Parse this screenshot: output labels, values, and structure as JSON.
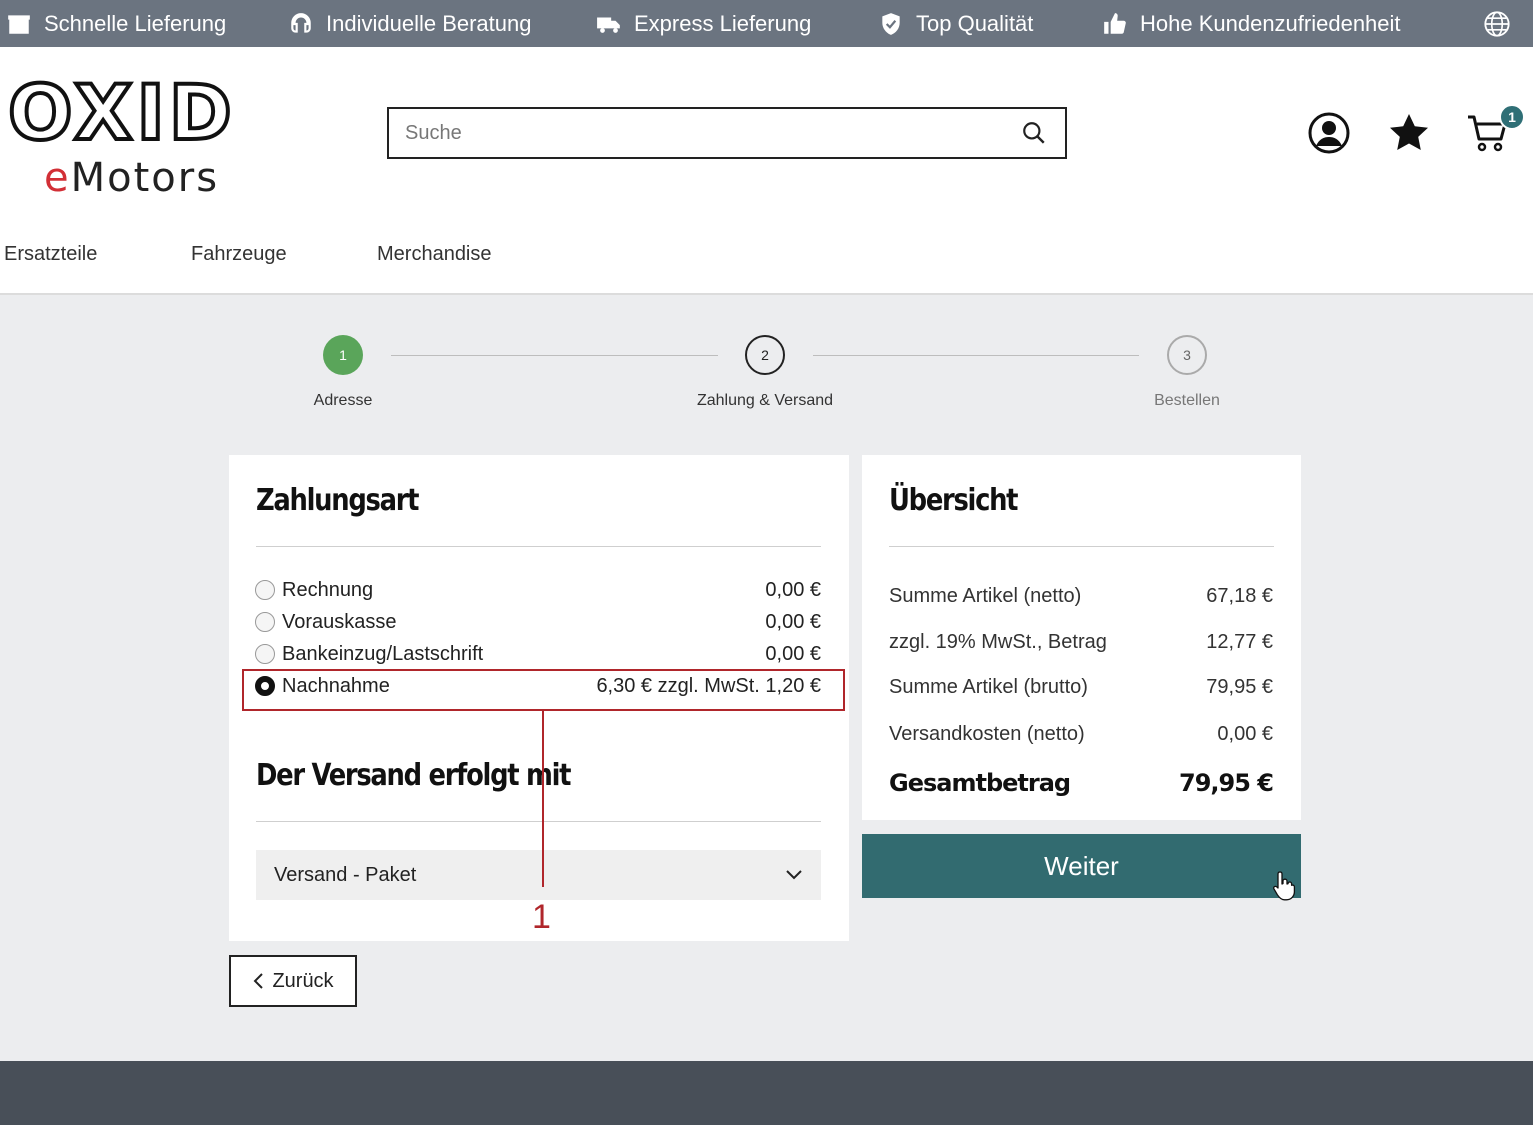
{
  "topbar": {
    "usps": [
      {
        "label": "Schnelle Lieferung",
        "icon": "box-icon"
      },
      {
        "label": "Individuelle Beratung",
        "icon": "headset-icon"
      },
      {
        "label": "Express Lieferung",
        "icon": "truck-icon"
      },
      {
        "label": "Top Qualität",
        "icon": "shield-icon"
      },
      {
        "label": "Hohe Kundenzufriedenheit",
        "icon": "thumbs-up-icon"
      }
    ],
    "language_icon": "globe-icon"
  },
  "header": {
    "logo": {
      "line1": "OXID",
      "line2_accent": "e",
      "line2_rest": "Motors"
    },
    "search": {
      "placeholder": "Suche"
    },
    "cart_count": "1"
  },
  "nav": {
    "items": [
      "Ersatzteile",
      "Fahrzeuge",
      "Merchandise"
    ]
  },
  "steps": [
    {
      "number": "1",
      "label": "Adresse",
      "state": "done"
    },
    {
      "number": "2",
      "label": "Zahlung & Versand",
      "state": "active"
    },
    {
      "number": "3",
      "label": "Bestellen",
      "state": "todo"
    }
  ],
  "payment": {
    "title": "Zahlungsart",
    "options": [
      {
        "label": "Rechnung",
        "price": "0,00 €",
        "selected": false
      },
      {
        "label": "Vorauskasse",
        "price": "0,00 €",
        "selected": false
      },
      {
        "label": "Bankeinzug/Lastschrift",
        "price": "0,00 €",
        "selected": false
      },
      {
        "label": "Nachnahme",
        "price": "6,30 € zzgl. MwSt. 1,20 €",
        "selected": true
      }
    ],
    "callout_number": "1"
  },
  "shipping": {
    "title": "Der Versand erfolgt mit",
    "selected": "Versand - Paket"
  },
  "summary": {
    "title": "Übersicht",
    "rows": [
      {
        "label": "Summe Artikel (netto)",
        "value": "67,18 €"
      },
      {
        "label": "zzgl. 19% MwSt., Betrag",
        "value": "12,77 €"
      },
      {
        "label": "Summe Artikel (brutto)",
        "value": "79,95 €"
      },
      {
        "label": "Versandkosten (netto)",
        "value": "0,00 €"
      }
    ],
    "total_label": "Gesamtbetrag",
    "total_value": "79,95 €"
  },
  "buttons": {
    "next": "Weiter",
    "back": "Zurück"
  },
  "colors": {
    "topbar": "#6b7480",
    "accent": "#326b70",
    "step_done": "#5aa55a",
    "highlight": "#b0262b",
    "footer": "#484f58"
  }
}
